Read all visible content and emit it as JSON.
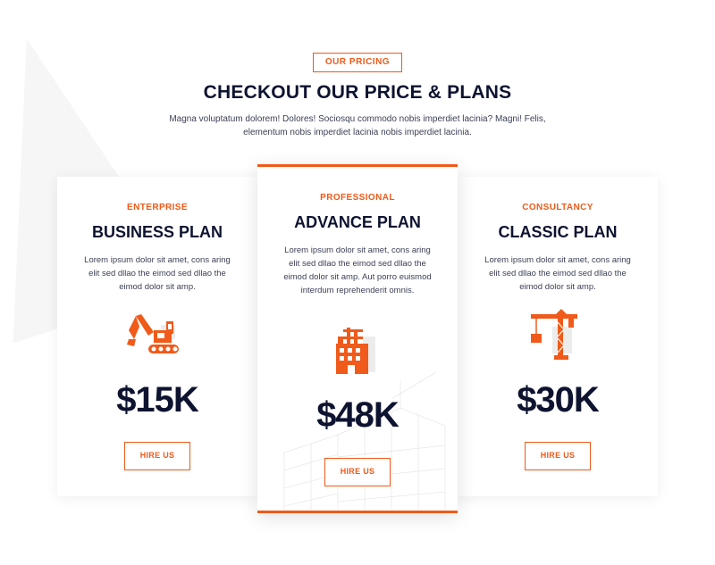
{
  "header": {
    "eyebrow": "OUR PRICING",
    "title": "CHECKOUT OUR PRICE & PLANS",
    "subtitle": "Magna voluptatum dolorem! Dolores! Sociosqu commodo nobis imperdiet lacinia? Magni! Felis, elementum nobis imperdiet lacinia nobis imperdiet lacinia."
  },
  "colors": {
    "accent": "#f05a1a",
    "heading": "#0e1330",
    "body": "#3b3f55"
  },
  "plans": [
    {
      "tier": "ENTERPRISE",
      "name": "BUSINESS PLAN",
      "description": "Lorem ipsum dolor sit amet, cons aring elit sed dllao the eimod sed dllao the eimod dolor sit amp.",
      "icon": "excavator-icon",
      "price": "$15K",
      "button": "HIRE US"
    },
    {
      "tier": "PROFESSIONAL",
      "name": "ADVANCE PLAN",
      "description": "Lorem ipsum dolor sit amet, cons aring elit sed dllao the eimod sed dllao the eimod dolor sit amp. Aut porro euismod interdum reprehenderit omnis.",
      "icon": "building-construction-icon",
      "price": "$48K",
      "button": "HIRE US"
    },
    {
      "tier": "CONSULTANCY",
      "name": "CLASSIC PLAN",
      "description": "Lorem ipsum dolor sit amet, cons aring elit sed dllao the eimod sed dllao the eimod dolor sit amp.",
      "icon": "tower-crane-icon",
      "price": "$30K",
      "button": "HIRE US"
    }
  ]
}
